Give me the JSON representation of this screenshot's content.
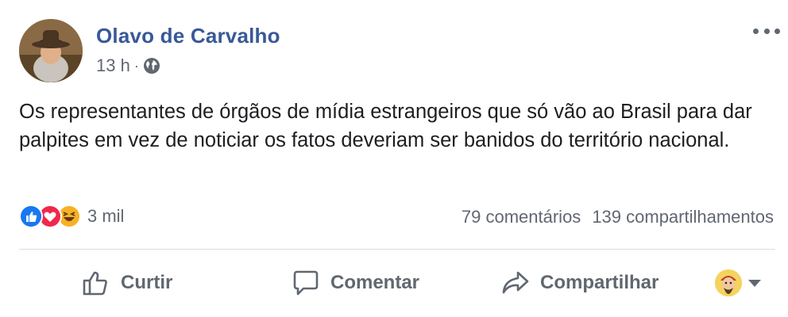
{
  "post": {
    "author": "Olavo de Carvalho",
    "time": "13 h",
    "separator": "·",
    "privacy_icon": "globe-icon",
    "text": "Os representantes de órgãos de mídia estrangeiros que só vão ao Brasil para dar palpites em vez de noticiar os fatos deveriam ser banidos do território nacional.",
    "reactions": {
      "icons": [
        "like-reaction-icon",
        "love-reaction-icon",
        "haha-reaction-icon"
      ],
      "count": "3 mil"
    },
    "comments": "79 comentários",
    "shares": "139 compartilhamentos"
  },
  "actions": {
    "like_label": "Curtir",
    "comment_label": "Comentar",
    "share_label": "Compartilhar"
  },
  "colors": {
    "author_link": "#385898",
    "secondary_text": "#606770",
    "like_blue": "#1877f2",
    "love_red": "#f0284a",
    "haha_yellow": "#f7b125"
  }
}
